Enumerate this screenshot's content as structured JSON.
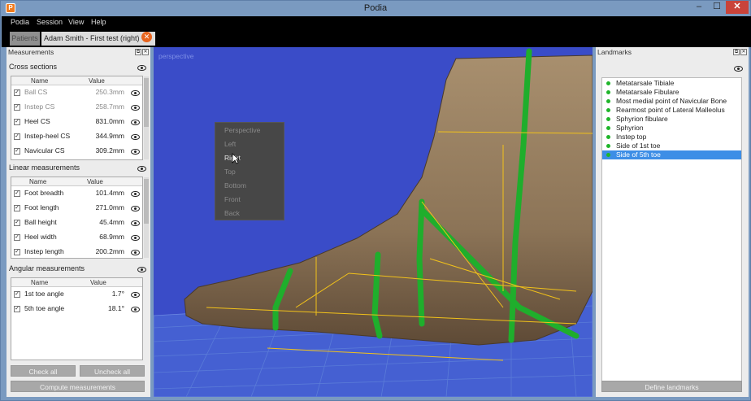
{
  "window": {
    "title": "Podia",
    "app_icon": "P",
    "minimize": "–",
    "maximize": "☐",
    "close": "✕"
  },
  "menu": [
    "Podia",
    "Session",
    "View",
    "Help"
  ],
  "tabs": {
    "patients": "Patients",
    "session": "Adam Smith - First test (right)",
    "close": "✕"
  },
  "measurements": {
    "panel_title": "Measurements",
    "cross_sections": {
      "title": "Cross sections",
      "headers": [
        "Name",
        "Value"
      ],
      "rows": [
        {
          "name": "Ball CS",
          "value": "250.3mm",
          "checked": true,
          "dim": true
        },
        {
          "name": "Instep CS",
          "value": "258.7mm",
          "checked": true,
          "dim": true
        },
        {
          "name": "Heel CS",
          "value": "831.0mm",
          "checked": true,
          "dim": false
        },
        {
          "name": "Instep-heel CS",
          "value": "344.9mm",
          "checked": true,
          "dim": false
        },
        {
          "name": "Navicular CS",
          "value": "309.2mm",
          "checked": true,
          "dim": false
        }
      ]
    },
    "linear": {
      "title": "Linear measurements",
      "headers": [
        "Name",
        "Value"
      ],
      "rows": [
        {
          "name": "Foot breadth",
          "value": "101.4mm",
          "checked": true
        },
        {
          "name": "Foot length",
          "value": "271.0mm",
          "checked": true
        },
        {
          "name": "Ball height",
          "value": "45.4mm",
          "checked": true
        },
        {
          "name": "Heel width",
          "value": "68.9mm",
          "checked": true
        },
        {
          "name": "Instep length",
          "value": "200.2mm",
          "checked": true
        }
      ]
    },
    "angular": {
      "title": "Angular measurements",
      "headers": [
        "Name",
        "Value"
      ],
      "rows": [
        {
          "name": "1st toe angle",
          "value": "1.7°",
          "checked": true
        },
        {
          "name": "5th toe angle",
          "value": "18.1°",
          "checked": true
        }
      ]
    },
    "check_all": "Check all",
    "uncheck_all": "Uncheck all",
    "compute": "Compute measurements"
  },
  "viewport": {
    "label": "perspective",
    "context_menu": [
      "Perspective",
      "Left",
      "Right",
      "Top",
      "Bottom",
      "Front",
      "Back"
    ],
    "highlighted": "Right"
  },
  "landmarks": {
    "panel_title": "Landmarks",
    "items": [
      "Metatarsale Tibiale",
      "Metatarsale Fibulare",
      "Most medial point of Navicular Bone",
      "Rearmost point of Lateral Malleolus",
      "Sphyrion fibulare",
      "Sphyrion",
      "Instep top",
      "Side of 1st toe",
      "Side of 5th toe"
    ],
    "selected_index": 8,
    "define_button": "Define landmarks"
  },
  "colors": {
    "viewport_bg": "#3a4cc8",
    "accent_green": "#1fb52a",
    "selection_blue": "#3d8ee6",
    "tab_close_orange": "#e8641d"
  }
}
